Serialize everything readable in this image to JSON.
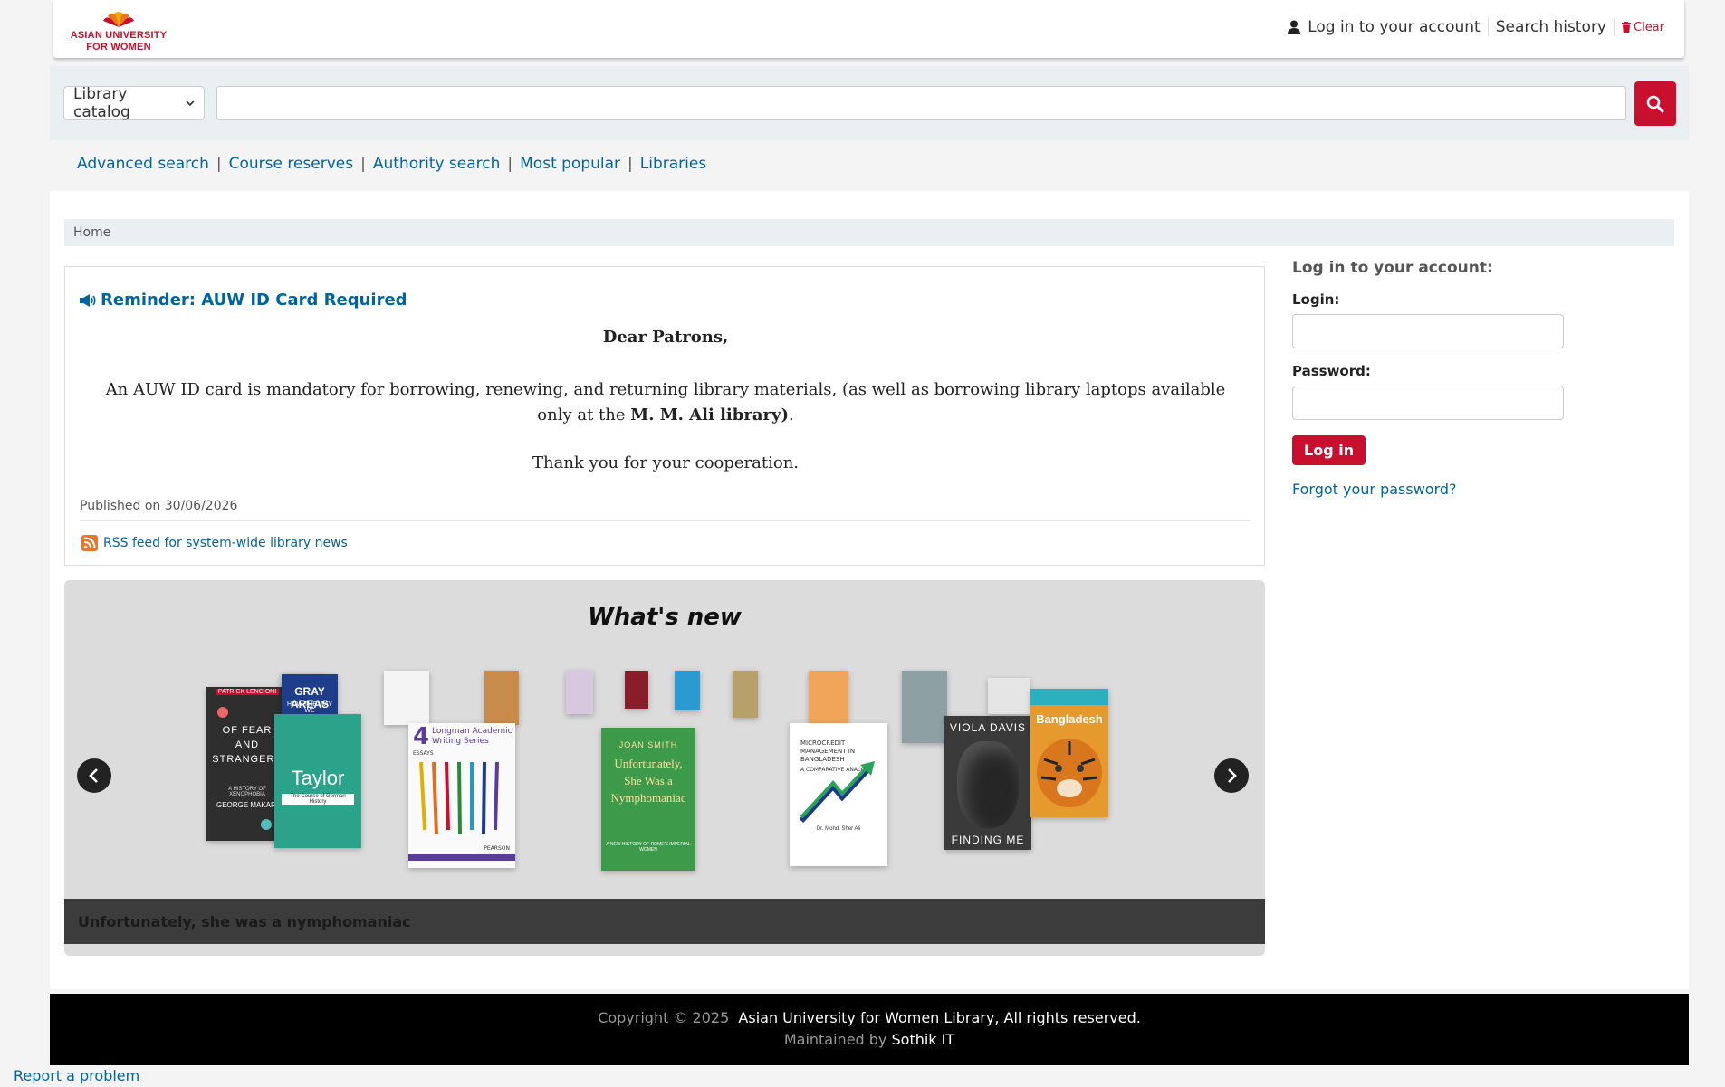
{
  "header": {
    "logo_line1": "ASIAN UNIVERSITY",
    "logo_line2": "FOR WOMEN",
    "login_link": "Log in to your account",
    "search_history": "Search history",
    "clear": "Clear"
  },
  "search": {
    "scope_selected": "Library catalog",
    "query_value": ""
  },
  "more_searches": [
    "Advanced search",
    "Course reserves",
    "Authority search",
    "Most popular",
    "Libraries"
  ],
  "breadcrumb": {
    "home": "Home"
  },
  "news": {
    "title": "Reminder: AUW ID Card Required",
    "greeting": "Dear Patrons,",
    "body_pre": "An AUW ID card is mandatory for borrowing, renewing, and returning library materials, (as well as borrowing library laptops available only at the ",
    "body_bold": "M. M. Ali library)",
    "body_post": ".",
    "thanks": "Thank you for your cooperation.",
    "published": "Published on 30/06/2026",
    "rss": "RSS feed for system-wide library news"
  },
  "carousel": {
    "title": "What's new",
    "caption": "Unfortunately, she was a nymphomaniac",
    "covers": {
      "fear_author": "PATRICK LENCIONI",
      "fear_title": "OF FEAR AND STRANGERS",
      "fear_sub": "A HISTORY OF XENOPHOBIA",
      "fear_byline": "GEORGE MAKARI",
      "gray_title": "GRAY AREAS",
      "gray_sub": "HOW THE WAY WE",
      "taylor_title": "Taylor",
      "taylor_sub": "The Course of German History",
      "longman_num": "4",
      "longman_title": "Longman Academic Writing Series",
      "longman_sub": "ESSAYS",
      "longman_pub": "PEARSON",
      "nympho_author": "JOAN SMITH",
      "nympho_title": "Unfortunately, She Was a Nymphomaniac",
      "nympho_sub": "A NEW HISTORY OF ROME'S IMPERIAL WOMEN",
      "micro_title": "MICROCREDIT MANAGEMENT IN BANGLADESH",
      "micro_sub": "A COMPARATIVE ANALYSIS",
      "micro_author": "Dr. Mohd. Sher Ali",
      "viola_author": "VIOLA DAVIS",
      "viola_title": "FINDING ME",
      "bangladesh_title": "Bangladesh"
    }
  },
  "login": {
    "heading": "Log in to your account:",
    "login_label": "Login:",
    "password_label": "Password:",
    "button": "Log in",
    "forgot": "Forgot your password?"
  },
  "footer": {
    "copyright": "Copyright © 2025",
    "org": "Asian University for Women Library, All rights reserved.",
    "maintained_by": "Maintained by",
    "maintainer": "Sothik IT"
  },
  "report_problem": "Report a problem",
  "colors": {
    "brand_red": "#c8102e",
    "link_blue": "#00649e",
    "footer_bg": "#000000"
  }
}
